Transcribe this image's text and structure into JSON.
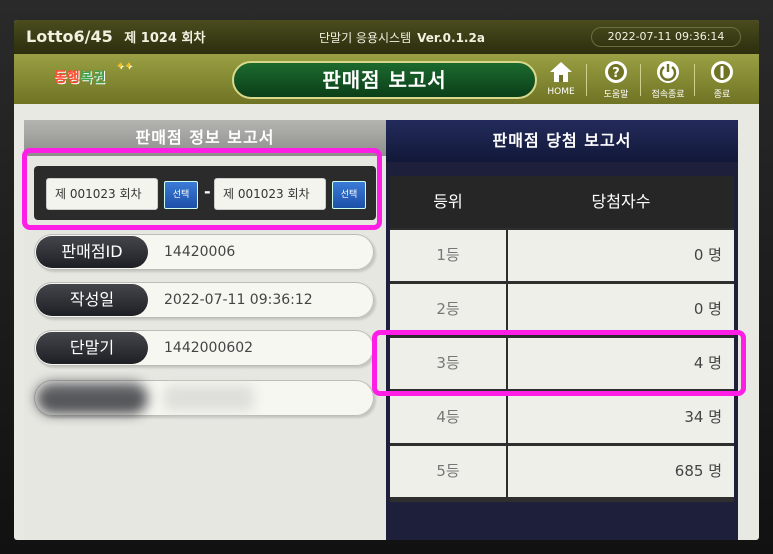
{
  "topbar": {
    "game": "Lotto6/45",
    "draw_prefix": "제",
    "draw_number": "1024",
    "draw_suffix": "회차",
    "system_name": "단말기 응용시스템",
    "version": "Ver.0.1.2a",
    "datetime": "2022-07-11  09:36:14"
  },
  "header": {
    "logo_part1": "동행",
    "logo_part2": "복권",
    "title": "판매점 보고서",
    "buttons": [
      {
        "label": "HOME",
        "icon": "home-icon"
      },
      {
        "label": "도움말",
        "icon": "help-icon"
      },
      {
        "label": "접속종료",
        "icon": "power-icon"
      },
      {
        "label": "종료",
        "icon": "exit-icon"
      }
    ]
  },
  "left_panel": {
    "tab_label": "판매점 정보 보고서",
    "range": {
      "from": "제 001023 회차",
      "to": "제 001023 회차",
      "select_label": "선택",
      "dash": "-"
    },
    "rows": [
      {
        "label": "판매점ID",
        "value": "14420006"
      },
      {
        "label": "작성일",
        "value": "2022-07-11  09:36:12"
      },
      {
        "label": "단말기",
        "value": "1442000602"
      }
    ]
  },
  "right_panel": {
    "tab_label": "판매점 당첨 보고서",
    "columns": [
      "등위",
      "당첨자수"
    ],
    "rows": [
      {
        "rank": "1등",
        "count": "0 명"
      },
      {
        "rank": "2등",
        "count": "0 명"
      },
      {
        "rank": "3등",
        "count": "4 명"
      },
      {
        "rank": "4등",
        "count": "34 명"
      },
      {
        "rank": "5등",
        "count": "685 명"
      }
    ]
  },
  "colors": {
    "highlight": "#ff1ee6",
    "header_green": "#6f7324",
    "title_pill": "#0b3f18",
    "right_tab_navy": "#121838"
  }
}
